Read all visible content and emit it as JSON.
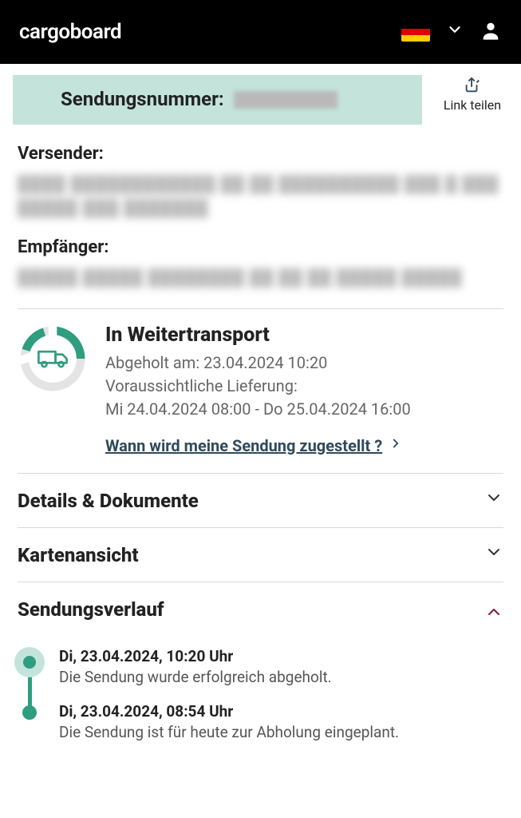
{
  "header": {
    "logo": "cargoboard",
    "flag": "de"
  },
  "banner": {
    "label": "Sendungsnummer:"
  },
  "share": {
    "label": "Link teilen"
  },
  "sender": {
    "label": "Versender:"
  },
  "recipient": {
    "label": "Empfänger:"
  },
  "status": {
    "title": "In Weitertransport",
    "picked_up": "Abgeholt am: 23.04.2024 10:20",
    "eta_label": "Voraussichtliche Lieferung:",
    "eta_value": "Mi 24.04.2024 08:00 - Do 25.04.2024 16:00",
    "faq": "Wann wird meine Sendung zugestellt ?"
  },
  "accordions": {
    "details": "Details & Dokumente",
    "map": "Kartenansicht",
    "history": "Sendungsverlauf"
  },
  "history": [
    {
      "time": "Di, 23.04.2024, 10:20 Uhr",
      "desc": "Die Sendung wurde erfolgreich abgeholt."
    },
    {
      "time": "Di, 23.04.2024, 08:54 Uhr",
      "desc": "Die Sendung ist für heute zur Abholung eingeplant."
    }
  ]
}
